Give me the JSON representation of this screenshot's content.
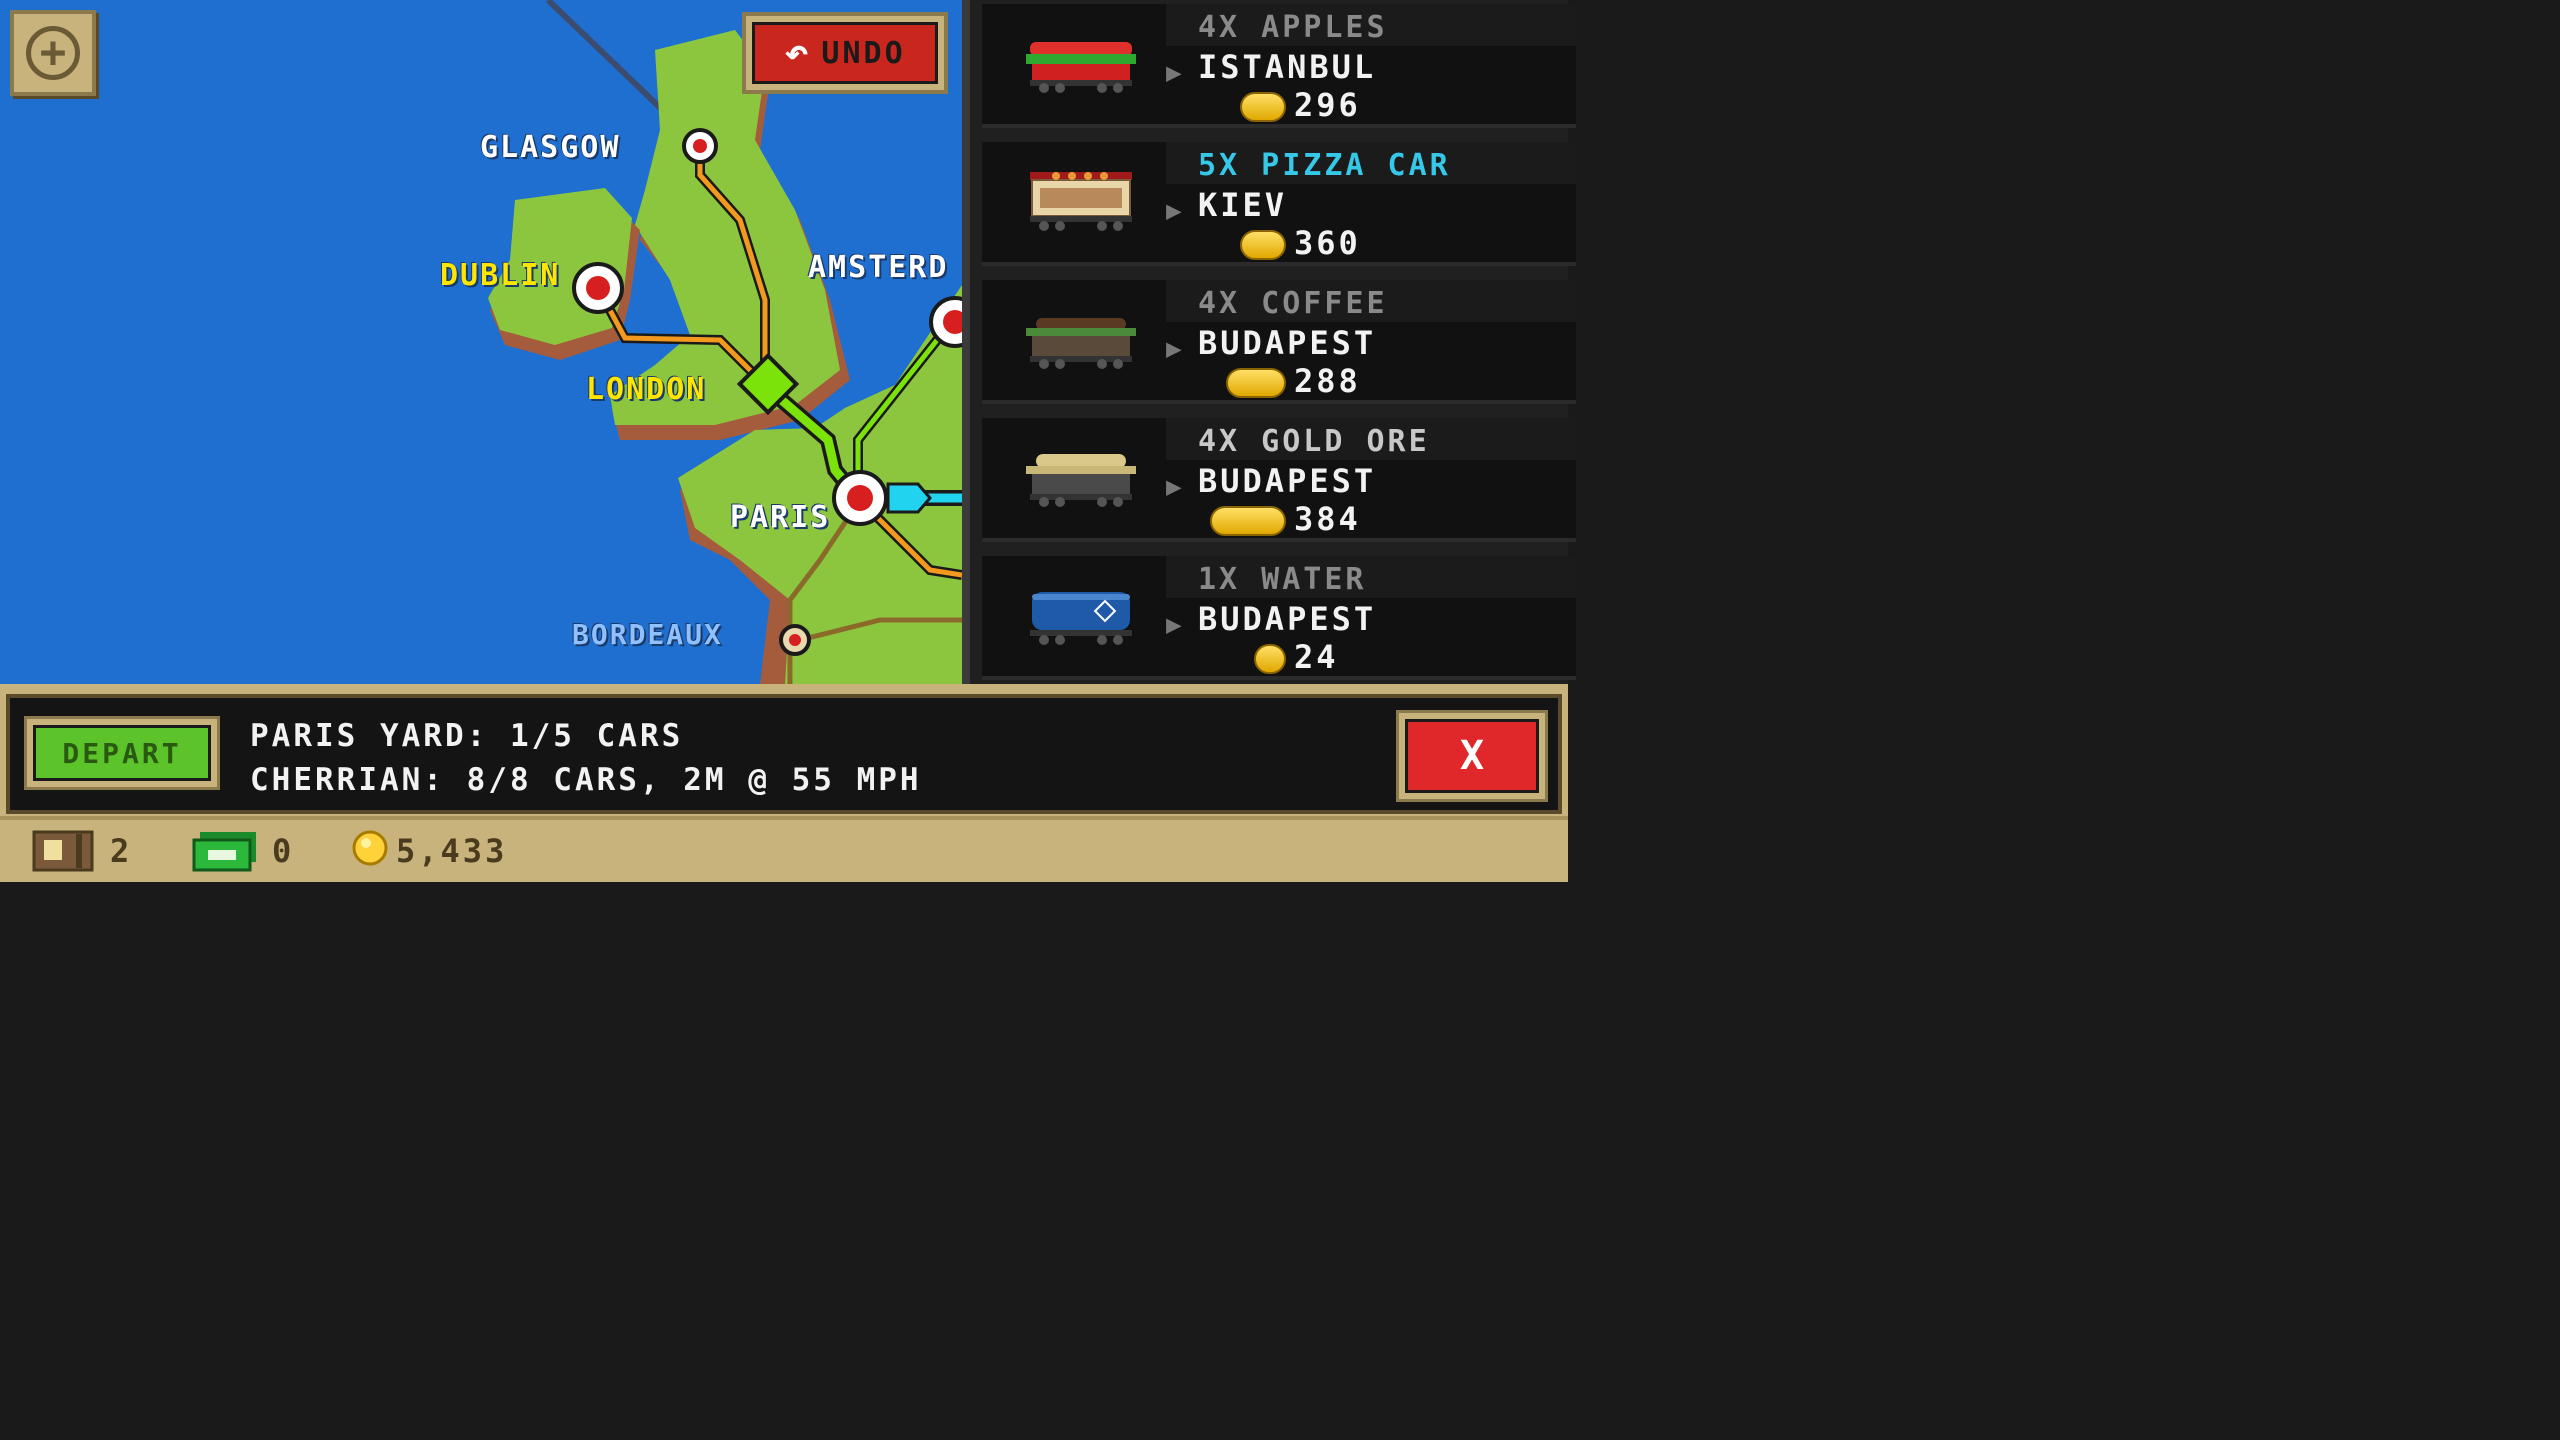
{
  "map": {
    "zoom_button": "+",
    "undo_label": "UNDO",
    "cities": [
      {
        "name": "GLASGOW",
        "color": "#ffffff"
      },
      {
        "name": "DUBLIN",
        "color": "#ffe600"
      },
      {
        "name": "AMSTERD",
        "color": "#ffffff"
      },
      {
        "name": "LONDON",
        "color": "#ffe600"
      },
      {
        "name": "PARIS",
        "color": "#ffffff"
      },
      {
        "name": "BORDEAUX",
        "color": "#8fc0ff"
      }
    ]
  },
  "cargo": [
    {
      "qty": "4X APPLES",
      "qty_color": "#8a8a8a",
      "destination": "ISTANBUL",
      "reward": "296",
      "car_icon": "apples-car-icon"
    },
    {
      "qty": "5X PIZZA CAR",
      "qty_color": "#35c8e8",
      "destination": "KIEV",
      "reward": "360",
      "car_icon": "pizza-car-icon"
    },
    {
      "qty": "4X COFFEE",
      "qty_color": "#8a8a8a",
      "destination": "BUDAPEST",
      "reward": "288",
      "car_icon": "coffee-car-icon"
    },
    {
      "qty": "4X GOLD ORE",
      "qty_color": "#c8c8c8",
      "destination": "BUDAPEST",
      "reward": "384",
      "car_icon": "gold-ore-car-icon"
    },
    {
      "qty": "1X WATER",
      "qty_color": "#8a8a8a",
      "destination": "BUDAPEST",
      "reward": "24",
      "car_icon": "water-tanker-icon"
    }
  ],
  "info": {
    "depart_label": "DEPART",
    "yard_line": "PARIS YARD: 1/5 CARS",
    "train_line": "CHERRIAN: 8/8 CARS, 2M @ 55 MPH",
    "close_label": "X"
  },
  "stats": {
    "crates": "2",
    "cash": "0",
    "coins": "5,433"
  },
  "colors": {
    "ocean": "#1f6fd1",
    "land": "#8cc63f",
    "route_orange": "#f39a1e",
    "route_green": "#7be30a",
    "route_cyan": "#22d3f0",
    "ui_tan": "#c7b37b"
  }
}
